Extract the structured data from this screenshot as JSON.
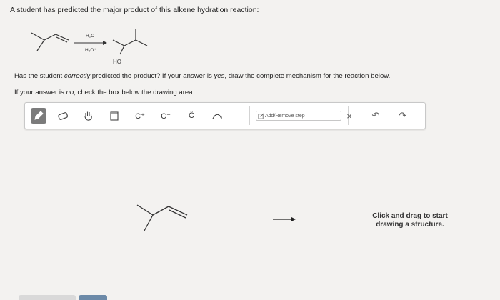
{
  "question": {
    "title": "A student has predicted the major product of this alkene hydration reaction:",
    "reagent_top": "H₂O",
    "reagent_bottom": "H₃O⁺",
    "product_label": "HO",
    "prompt_line1_a": "Has the student ",
    "prompt_line1_em1": "correctly",
    "prompt_line1_b": " predicted the product? If your answer is ",
    "prompt_line1_em2": "yes",
    "prompt_line1_c": ", draw the complete mechanism for the reaction below.",
    "prompt_line2_a": "If your answer is ",
    "prompt_line2_em": "no",
    "prompt_line2_b": ", check the box below the drawing area."
  },
  "toolbar": {
    "c_plus": "C⁺",
    "c_minus": "C⁻",
    "c_radical": "C̈",
    "add_remove_step": "Add/Remove step",
    "clear": "×",
    "undo": "↶",
    "redo": "↷"
  },
  "canvas": {
    "hint": "Click and drag to start drawing a structure."
  },
  "icons": [
    "pencil-icon",
    "eraser-icon",
    "hand-icon",
    "copy-icon",
    "curved-arrow-icon",
    "edit-icon",
    "undo-icon",
    "redo-icon"
  ]
}
